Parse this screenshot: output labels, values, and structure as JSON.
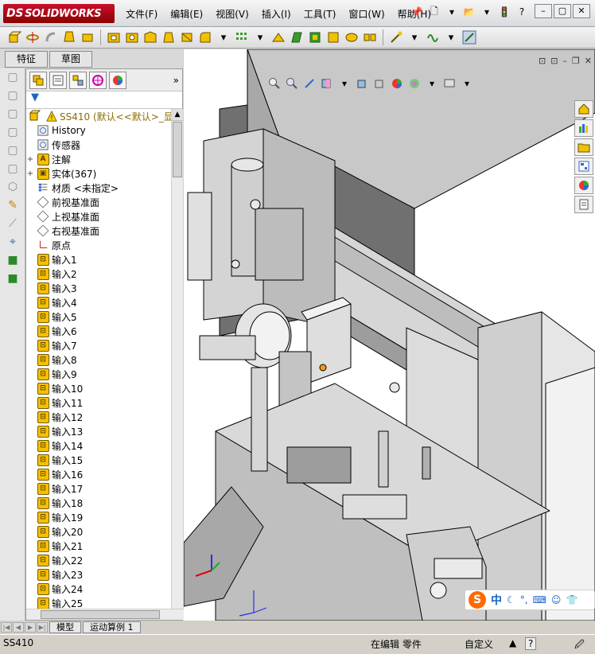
{
  "app": {
    "logo_prefix": "DS",
    "logo_text": "SOLIDWORKS",
    "menus": [
      "文件(F)",
      "编辑(E)",
      "视图(V)",
      "插入(I)",
      "工具(T)",
      "窗口(W)",
      "帮助(H)"
    ],
    "window_buttons": [
      "–",
      "▢",
      "✕"
    ]
  },
  "panel_tabs": {
    "feature": "特征",
    "sketch": "草图"
  },
  "tree": {
    "root": "SS410  (默认<<默认>_显示",
    "nodes": [
      {
        "label": "History",
        "icon": "history-icon"
      },
      {
        "label": "传感器",
        "icon": "sensor-icon"
      },
      {
        "label": "注解",
        "icon": "annotation-icon",
        "expand": "+"
      },
      {
        "label": "实体(367)",
        "icon": "solid-bodies-icon",
        "expand": "+"
      },
      {
        "label": "材质 <未指定>",
        "icon": "material-icon"
      },
      {
        "label": "前视基准面",
        "icon": "plane-icon"
      },
      {
        "label": "上视基准面",
        "icon": "plane-icon"
      },
      {
        "label": "右视基准面",
        "icon": "plane-icon"
      },
      {
        "label": "原点",
        "icon": "origin-icon"
      }
    ],
    "inputs": [
      "输入1",
      "输入2",
      "输入3",
      "输入4",
      "输入5",
      "输入6",
      "输入7",
      "输入8",
      "输入9",
      "输入10",
      "输入11",
      "输入12",
      "输入13",
      "输入14",
      "输入15",
      "输入16",
      "输入17",
      "输入18",
      "输入19",
      "输入20",
      "输入21",
      "输入22",
      "输入23",
      "输入24",
      "输入25"
    ]
  },
  "bottom_tabs": {
    "model": "模型",
    "motion": "运动算例 1"
  },
  "status": {
    "file": "SS410",
    "mode": "在编辑 零件",
    "units": "自定义",
    "help": "?"
  },
  "ime": {
    "logo": "S",
    "lang": "中"
  },
  "colors": {
    "accent": "#1b64c6",
    "logo_red": "#c8102e",
    "input_icon": "#f5c000"
  }
}
